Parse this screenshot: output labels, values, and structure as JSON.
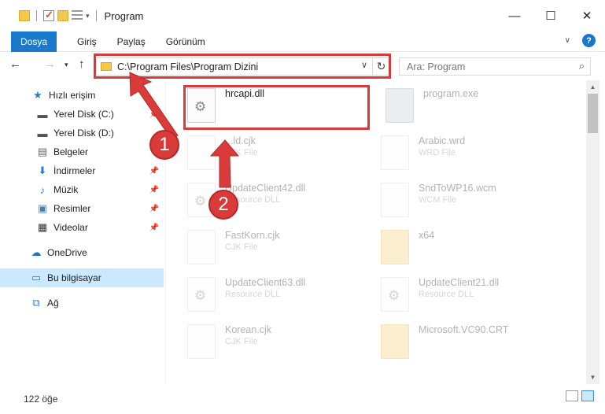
{
  "window": {
    "title": "Program",
    "controls": {
      "minimize": "—",
      "maximize": "☐",
      "close": "✕"
    }
  },
  "ribbon": {
    "tabs": [
      "Dosya",
      "Giriş",
      "Paylaş",
      "Görünüm"
    ],
    "help": "?"
  },
  "nav": {
    "address_path": "C:\\Program Files\\Program Dizini",
    "search_placeholder": "Ara: Program"
  },
  "sidebar": {
    "items": [
      {
        "label": "Hızlı erişim",
        "icon": "star-icon"
      },
      {
        "label": "Yerel Disk (C:)",
        "icon": "drive-icon"
      },
      {
        "label": "Yerel Disk (D:)",
        "icon": "drive-icon"
      },
      {
        "label": "Belgeler",
        "icon": "documents-icon"
      },
      {
        "label": "İndirmeler",
        "icon": "download-icon"
      },
      {
        "label": "Müzik",
        "icon": "music-icon"
      },
      {
        "label": "Resimler",
        "icon": "pictures-icon"
      },
      {
        "label": "Videolar",
        "icon": "video-icon"
      },
      {
        "label": "OneDrive",
        "icon": "cloud-icon"
      },
      {
        "label": "Bu bilgisayar",
        "icon": "computer-icon"
      },
      {
        "label": "Ağ",
        "icon": "network-icon"
      }
    ]
  },
  "files": [
    {
      "name": "hrcapi.dll",
      "type": ""
    },
    {
      "name": "program.exe",
      "type": ""
    },
    {
      "name": "...ld.cjk",
      "type": "CJK File"
    },
    {
      "name": "Arabic.wrd",
      "type": "WRD File"
    },
    {
      "name": "UpdateClient42.dll",
      "type": "Resource DLL"
    },
    {
      "name": "SndToWP16.wcm",
      "type": "WCM File"
    },
    {
      "name": "FastKorn.cjk",
      "type": "CJK File"
    },
    {
      "name": "x64",
      "type": ""
    },
    {
      "name": "UpdateClient63.dll",
      "type": "Resource DLL"
    },
    {
      "name": "UpdateClient21.dll",
      "type": "Resource DLL"
    },
    {
      "name": "Korean.cjk",
      "type": "CJK File"
    },
    {
      "name": "Microsoft.VC90.CRT",
      "type": ""
    }
  ],
  "status": {
    "count": "122 öğe"
  },
  "annotations": {
    "step1": "1",
    "step2": "2"
  },
  "colors": {
    "accent": "#1979ca",
    "highlight": "#d93a3a",
    "selected": "#cce8ff"
  }
}
